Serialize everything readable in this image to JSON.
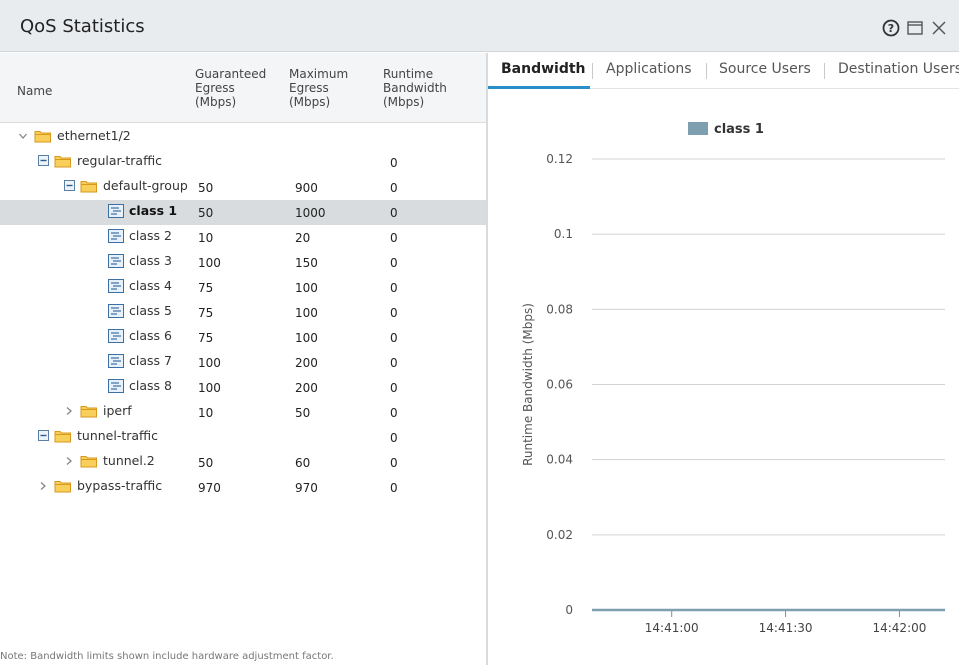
{
  "window": {
    "title": "QoS Statistics"
  },
  "table": {
    "headers": {
      "name": "Name",
      "guaranteed": [
        "Guaranteed",
        "Egress",
        "(Mbps)"
      ],
      "maximum": [
        "Maximum",
        "Egress",
        "(Mbps)"
      ],
      "runtime": [
        "Runtime",
        "Bandwidth",
        "(Mbps)"
      ]
    },
    "rows": [
      {
        "name": "ethernet1/2",
        "guaranteed": "",
        "maximum": "",
        "runtime": ""
      },
      {
        "name": "regular-traffic",
        "guaranteed": "",
        "maximum": "",
        "runtime": "0"
      },
      {
        "name": "default-group",
        "guaranteed": "50",
        "maximum": "900",
        "runtime": "0"
      },
      {
        "name": "class 1",
        "guaranteed": "50",
        "maximum": "1000",
        "runtime": "0"
      },
      {
        "name": "class 2",
        "guaranteed": "10",
        "maximum": "20",
        "runtime": "0"
      },
      {
        "name": "class 3",
        "guaranteed": "100",
        "maximum": "150",
        "runtime": "0"
      },
      {
        "name": "class 4",
        "guaranteed": "75",
        "maximum": "100",
        "runtime": "0"
      },
      {
        "name": "class 5",
        "guaranteed": "75",
        "maximum": "100",
        "runtime": "0"
      },
      {
        "name": "class 6",
        "guaranteed": "75",
        "maximum": "100",
        "runtime": "0"
      },
      {
        "name": "class 7",
        "guaranteed": "100",
        "maximum": "200",
        "runtime": "0"
      },
      {
        "name": "class 8",
        "guaranteed": "100",
        "maximum": "200",
        "runtime": "0"
      },
      {
        "name": "iperf",
        "guaranteed": "10",
        "maximum": "50",
        "runtime": "0"
      },
      {
        "name": "tunnel-traffic",
        "guaranteed": "",
        "maximum": "",
        "runtime": "0"
      },
      {
        "name": "tunnel.2",
        "guaranteed": "50",
        "maximum": "60",
        "runtime": "0"
      },
      {
        "name": "bypass-traffic",
        "guaranteed": "970",
        "maximum": "970",
        "runtime": "0"
      }
    ],
    "note": "Note: Bandwidth limits shown include hardware adjustment factor."
  },
  "tabs": {
    "bandwidth": "Bandwidth",
    "applications": "Applications",
    "source_users": "Source Users",
    "destination_users": "Destination Users"
  },
  "icons": [
    "help-icon",
    "maximize-icon",
    "close-icon",
    "folder-icon",
    "class-icon",
    "chevron-right-icon",
    "chevron-down-icon",
    "collapse-icon"
  ],
  "colors": {
    "accent": "#2a8fc9",
    "series": "#7e9fb0",
    "folder": "#f2b632",
    "selected_row": "#d8dcdf"
  },
  "chart_data": {
    "type": "line",
    "ylabel": "Runtime Bandwidth (Mbps)",
    "xlabel": "",
    "yticks": [
      "0",
      "0.02",
      "0.04",
      "0.06",
      "0.08",
      "0.1",
      "0.12"
    ],
    "ylim": [
      0,
      0.12
    ],
    "xticks": [
      "14:41:00",
      "14:41:30",
      "14:42:00"
    ],
    "legend_position": "top",
    "grid": true,
    "series": [
      {
        "name": "class 1",
        "x": [
          "14:40:39",
          "14:41:00",
          "14:41:30",
          "14:42:00",
          "14:42:12"
        ],
        "values": [
          0,
          0,
          0,
          0,
          0
        ]
      }
    ]
  }
}
